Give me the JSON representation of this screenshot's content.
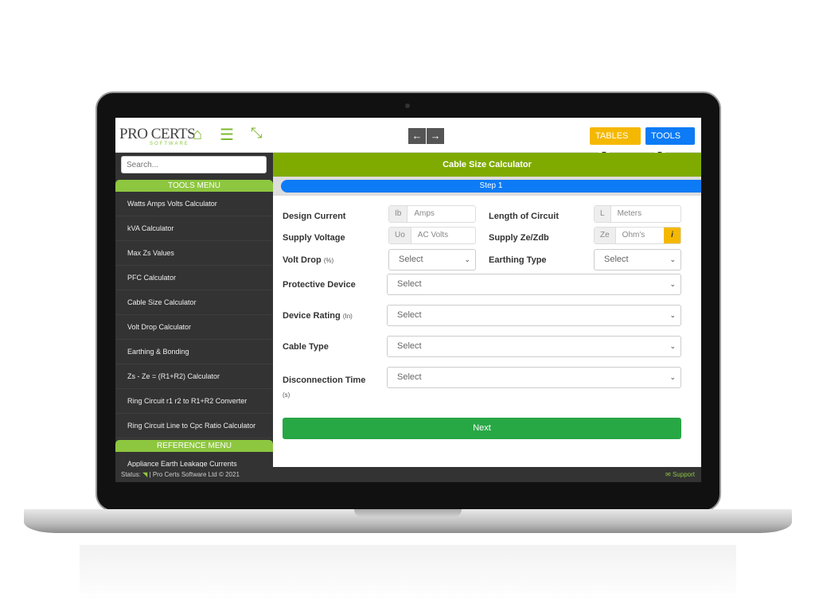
{
  "header": {
    "logo": "PRO CERTS",
    "logo_sub": "SOFTWARE",
    "back": "←",
    "forward": "→",
    "tables": "TABLES",
    "tools": "TOOLS",
    "colors": {
      "tables": "#f5b800",
      "tools": "#0d7bf5",
      "brand": "#8dc63f"
    }
  },
  "sidebar": {
    "search_placeholder": "Search...",
    "tools_menu": "TOOLS MENU",
    "items": [
      "Watts Amps Volts Calculator",
      "kVA Calculator",
      "Max Zs Values",
      "PFC Calculator",
      "Cable Size Calculator",
      "Volt Drop Calculator",
      "Earthing & Bonding",
      "Zs - Ze = (R1+R2) Calculator",
      "Ring Circuit r1 r2 to R1+R2 Converter",
      "Ring Circuit Line to Cpc Ratio Calculator"
    ],
    "reference_menu": "REFERENCE MENU",
    "ref_items": [
      "Appliance Earth Leakage Currents"
    ]
  },
  "main": {
    "title": "Cable Size Calculator",
    "step": "Step 1",
    "design_current": {
      "label": "Design Current",
      "prefix": "Ib",
      "placeholder": "Amps"
    },
    "length": {
      "label": "Length of Circuit",
      "prefix": "L",
      "placeholder": "Meters"
    },
    "supply_voltage": {
      "label": "Supply Voltage",
      "prefix": "Uo",
      "placeholder": "AC Volts"
    },
    "supply_ze": {
      "label": "Supply Ze/Zdb",
      "prefix": "Ze",
      "placeholder": "Ohm's",
      "info": "i"
    },
    "volt_drop": {
      "label": "Volt Drop",
      "unit": "(%)",
      "value": "Select"
    },
    "earthing_type": {
      "label": "Earthing Type",
      "value": "Select"
    },
    "protective_device": {
      "label": "Protective Device",
      "value": "Select"
    },
    "device_rating": {
      "label": "Device Rating",
      "unit": "(In)",
      "value": "Select"
    },
    "cable_type": {
      "label": "Cable Type",
      "value": "Select"
    },
    "disconnection_time": {
      "label": "Disconnection Time",
      "unit": "(s)",
      "value": "Select"
    },
    "next": "Next"
  },
  "footer": {
    "status": "Status:",
    "copyright": "| Pro Certs Software Ltd © 2021",
    "support": "Support"
  }
}
